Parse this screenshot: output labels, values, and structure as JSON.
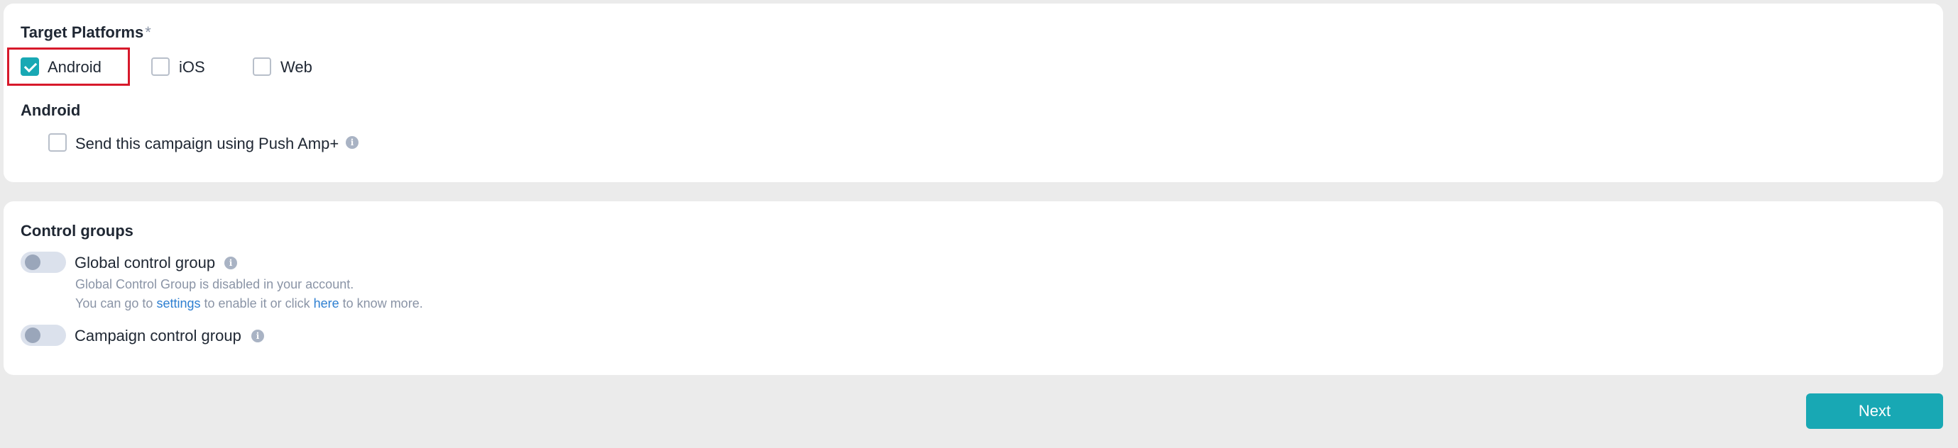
{
  "target_platforms": {
    "title": "Target Platforms",
    "required_mark": "*",
    "options": [
      {
        "label": "Android",
        "checked": true
      },
      {
        "label": "iOS",
        "checked": false
      },
      {
        "label": "Web",
        "checked": false
      }
    ]
  },
  "android_section": {
    "title": "Android",
    "push_amp_label": "Send this campaign using Push Amp+",
    "push_amp_checked": false,
    "info_icon": "info-icon"
  },
  "control_groups": {
    "title": "Control groups",
    "global": {
      "label": "Global control group",
      "enabled": false,
      "help_line1": "Global Control Group is disabled in your account.",
      "help_line2_prefix": "You can go to",
      "settings_link": "settings",
      "help_line2_middle": "to enable it or click",
      "here_link": "here",
      "help_line2_suffix": "to know more."
    },
    "campaign": {
      "label": "Campaign control group",
      "enabled": false
    }
  },
  "footer": {
    "next_label": "Next"
  },
  "colors": {
    "accent": "#18a8b4",
    "highlight": "#d7192b",
    "link": "#2e7fd1"
  }
}
